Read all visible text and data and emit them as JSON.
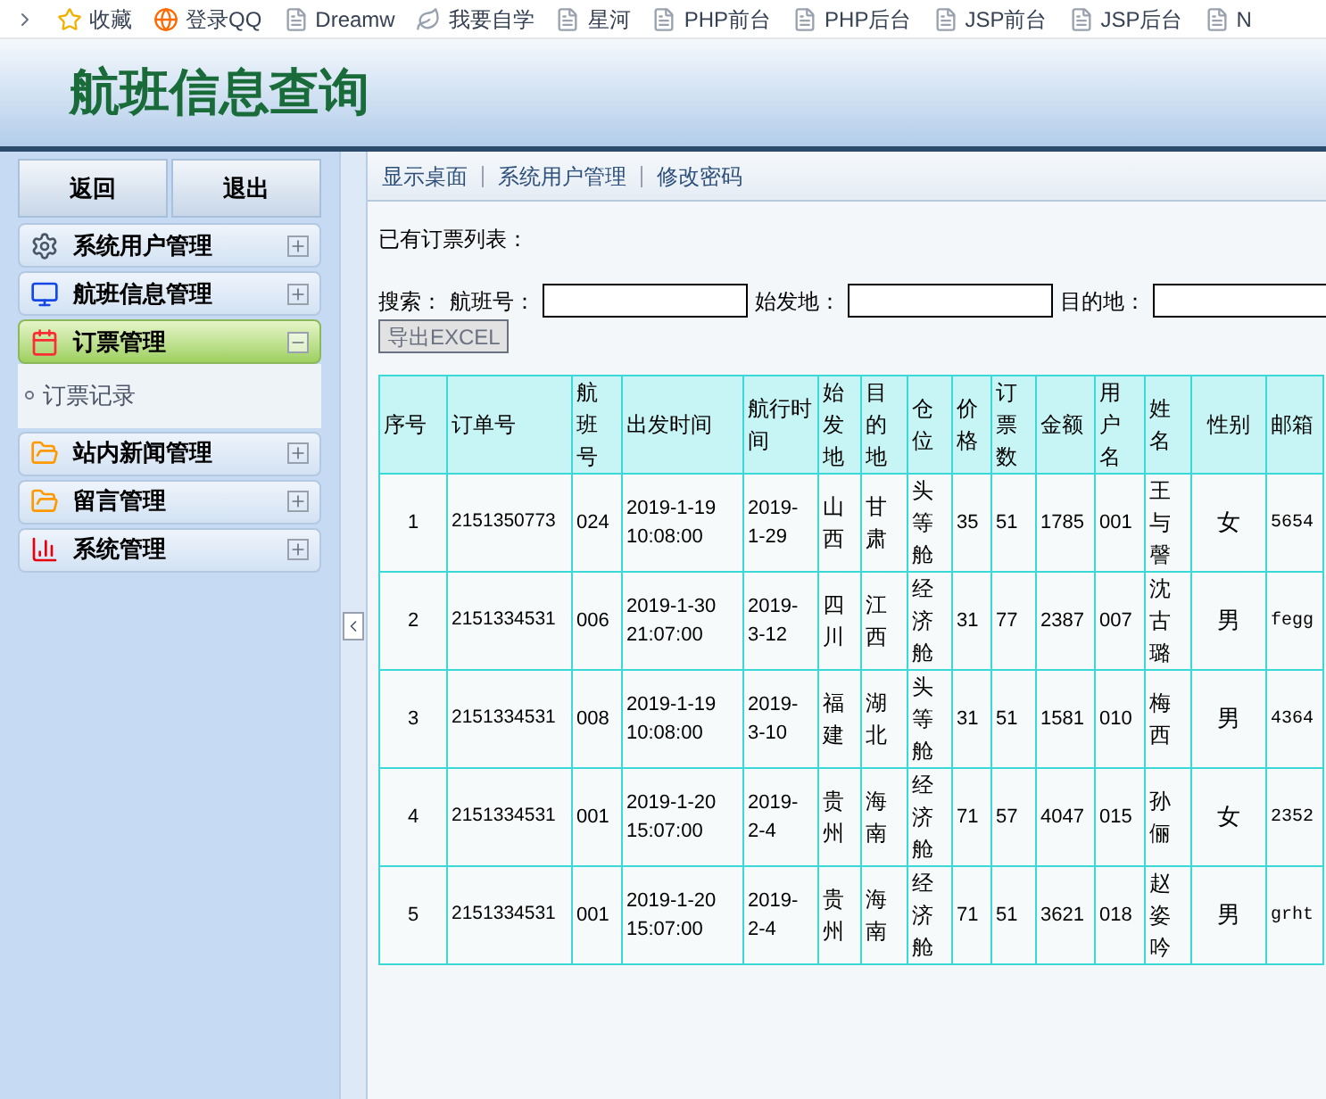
{
  "bookmarks": [
    {
      "label": "收藏"
    },
    {
      "label": "登录QQ"
    },
    {
      "label": "Dreamw"
    },
    {
      "label": "我要自学"
    },
    {
      "label": "星河"
    },
    {
      "label": "PHP前台"
    },
    {
      "label": "PHP后台"
    },
    {
      "label": "JSP前台"
    },
    {
      "label": "JSP后台"
    },
    {
      "label": "N"
    }
  ],
  "header": {
    "title": "航班信息查询"
  },
  "sidebar": {
    "buttons": [
      "返回",
      "退出"
    ],
    "groups": [
      {
        "label": "系统用户管理",
        "expanded": false
      },
      {
        "label": "航班信息管理",
        "expanded": false
      },
      {
        "label": "订票管理",
        "expanded": true,
        "children": [
          {
            "label": "订票记录"
          }
        ]
      },
      {
        "label": "站内新闻管理",
        "expanded": false
      },
      {
        "label": "留言管理",
        "expanded": false
      },
      {
        "label": "系统管理",
        "expanded": false
      }
    ]
  },
  "top_links": [
    "显示桌面",
    "系统用户管理",
    "修改密码"
  ],
  "list_title": "已有订票列表：",
  "search": {
    "label": "搜索：",
    "fields": [
      {
        "label": "航班号："
      },
      {
        "label": "始发地："
      },
      {
        "label": "目的地："
      }
    ],
    "export_button": "导出EXCEL"
  },
  "table": {
    "columns": [
      "序号",
      "订单号",
      "航班号",
      "出发时间",
      "航行时间",
      "始发地",
      "目的地",
      "仓位",
      "价格",
      "订票数",
      "金额",
      "用户名",
      "姓名",
      "性别",
      "邮箱"
    ],
    "rows": [
      [
        "1",
        "2151350773",
        "024",
        "2019-1-19 10:08:00",
        "2019-1-29",
        "山西",
        "甘肃",
        "头等舱",
        "35",
        "51",
        "1785",
        "001",
        "王与謦",
        "女",
        "5654"
      ],
      [
        "2",
        "2151334531",
        "006",
        "2019-1-30 21:07:00",
        "2019-3-12",
        "四川",
        "江西",
        "经济舱",
        "31",
        "77",
        "2387",
        "007",
        "沈古璐",
        "男",
        "fegg"
      ],
      [
        "3",
        "2151334531",
        "008",
        "2019-1-19 10:08:00",
        "2019-3-10",
        "福建",
        "湖北",
        "头等舱",
        "31",
        "51",
        "1581",
        "010",
        "梅西",
        "男",
        "4364"
      ],
      [
        "4",
        "2151334531",
        "001",
        "2019-1-20 15:07:00",
        "2019-2-4",
        "贵州",
        "海南",
        "经济舱",
        "71",
        "57",
        "4047",
        "015",
        "孙俪",
        "女",
        "2352"
      ],
      [
        "5",
        "2151334531",
        "001",
        "2019-1-20 15:07:00",
        "2019-2-4",
        "贵州",
        "海南",
        "经济舱",
        "71",
        "51",
        "3621",
        "018",
        "赵姿吟",
        "男",
        "grht"
      ]
    ]
  }
}
